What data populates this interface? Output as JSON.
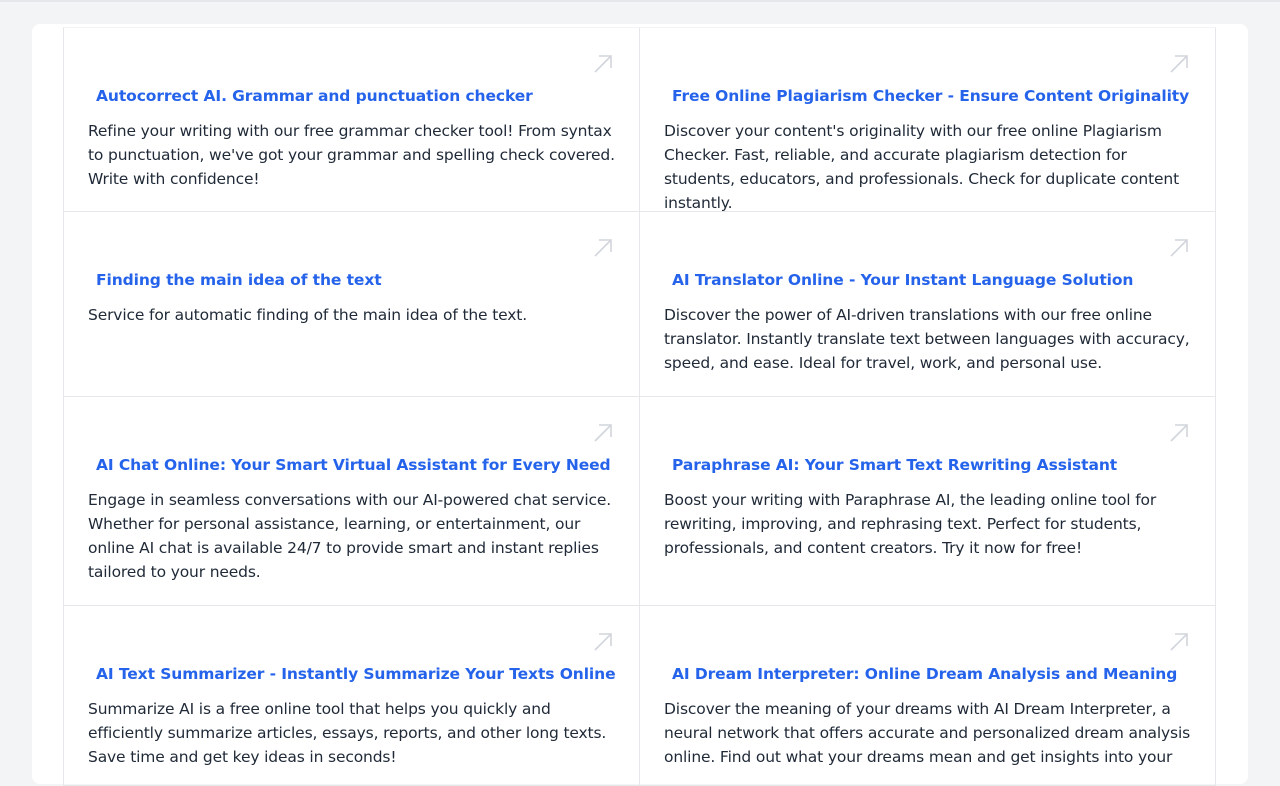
{
  "cards": [
    {
      "title": "Autocorrect AI. Grammar and punctuation checker",
      "description": "Refine your writing with our free grammar checker tool! From syntax to punctuation, we've got your grammar and spelling check covered. Write with confidence!",
      "icon": "arrow-up-right-icon"
    },
    {
      "title": "Free Online Plagiarism Checker - Ensure Content Originality",
      "description": "Discover your content's originality with our free online Plagiarism Checker. Fast, reliable, and accurate plagiarism detection for students, educators, and professionals. Check for duplicate content instantly.",
      "icon": "arrow-up-right-icon"
    },
    {
      "title": "Finding the main idea of the text",
      "description": "Service for automatic finding of the main idea of the text.",
      "icon": "arrow-up-right-icon"
    },
    {
      "title": "AI Translator Online - Your Instant Language Solution",
      "description": "Discover the power of AI-driven translations with our free online translator. Instantly translate text between languages with accuracy, speed, and ease. Ideal for travel, work, and personal use.",
      "icon": "arrow-up-right-icon"
    },
    {
      "title": "AI Chat Online: Your Smart Virtual Assistant for Every Need",
      "description": "Engage in seamless conversations with our AI-powered chat service. Whether for personal assistance, learning, or entertainment, our online AI chat is available 24/7 to provide smart and instant replies tailored to your needs.",
      "icon": "arrow-up-right-icon"
    },
    {
      "title": "Paraphrase AI: Your Smart Text Rewriting Assistant",
      "description": "Boost your writing with Paraphrase AI, the leading online tool for rewriting, improving, and rephrasing text. Perfect for students, professionals, and content creators. Try it now for free!",
      "icon": "arrow-up-right-icon"
    },
    {
      "title": "AI Text Summarizer - Instantly Summarize Your Texts Online",
      "description": "Summarize AI is a free online tool that helps you quickly and efficiently summarize articles, essays, reports, and other long texts. Save time and get key ideas in seconds!",
      "icon": "arrow-up-right-icon"
    },
    {
      "title": "AI Dream Interpreter: Online Dream Analysis and Meaning",
      "description": "Discover the meaning of your dreams with AI Dream Interpreter, a neural network that offers accurate and personalized dream analysis online. Find out what your dreams mean and get insights into your",
      "icon": "arrow-up-right-icon"
    }
  ],
  "colors": {
    "link": "#2563eb",
    "text": "#1f2937",
    "border": "#e5e7eb",
    "icon": "#d1d5db",
    "background": "#f3f4f6"
  }
}
